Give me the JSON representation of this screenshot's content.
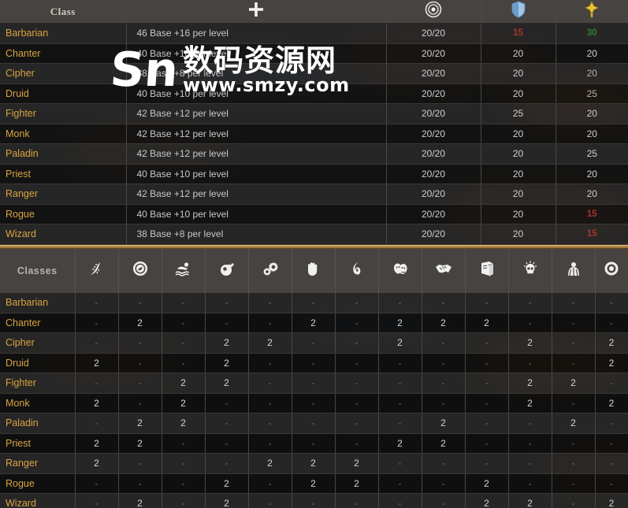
{
  "top_table": {
    "headers": [
      {
        "label": "Class",
        "icon": null,
        "name": "class"
      },
      {
        "label": "",
        "icon": "health-plus-icon",
        "name": "health"
      },
      {
        "label": "",
        "icon": "accuracy-target-icon",
        "name": "accuracy"
      },
      {
        "label": "",
        "icon": "deflection-shield-icon",
        "name": "deflection"
      },
      {
        "label": "",
        "icon": "defense-cross-icon",
        "name": "defense"
      }
    ],
    "rows": [
      {
        "cls": "Barbarian",
        "health": "46 Base +16 per level",
        "accuracy": "20/20",
        "deflection": "15",
        "deflection_style": "red",
        "defense": "30",
        "defense_style": "green"
      },
      {
        "cls": "Chanter",
        "health": "40 Base +10 per level",
        "accuracy": "20/20",
        "deflection": "20",
        "deflection_style": "",
        "defense": "20",
        "defense_style": ""
      },
      {
        "cls": "Cipher",
        "health": "38 Base +8 per level",
        "accuracy": "20/20",
        "deflection": "20",
        "deflection_style": "",
        "defense": "20",
        "defense_style": "dim"
      },
      {
        "cls": "Druid",
        "health": "40 Base +10 per level",
        "accuracy": "20/20",
        "deflection": "20",
        "deflection_style": "",
        "defense": "25",
        "defense_style": "dim"
      },
      {
        "cls": "Fighter",
        "health": "42 Base +12 per level",
        "accuracy": "20/20",
        "deflection": "25",
        "deflection_style": "",
        "defense": "20",
        "defense_style": ""
      },
      {
        "cls": "Monk",
        "health": "42 Base +12 per level",
        "accuracy": "20/20",
        "deflection": "20",
        "deflection_style": "",
        "defense": "20",
        "defense_style": ""
      },
      {
        "cls": "Paladin",
        "health": "42 Base +12 per level",
        "accuracy": "20/20",
        "deflection": "20",
        "deflection_style": "",
        "defense": "25",
        "defense_style": ""
      },
      {
        "cls": "Priest",
        "health": "40 Base +10 per level",
        "accuracy": "20/20",
        "deflection": "20",
        "deflection_style": "",
        "defense": "20",
        "defense_style": ""
      },
      {
        "cls": "Ranger",
        "health": "42 Base +12 per level",
        "accuracy": "20/20",
        "deflection": "20",
        "deflection_style": "",
        "defense": "20",
        "defense_style": ""
      },
      {
        "cls": "Rogue",
        "health": "40 Base +10 per level",
        "accuracy": "20/20",
        "deflection": "20",
        "deflection_style": "",
        "defense": "15",
        "defense_style": "red"
      },
      {
        "cls": "Wizard",
        "health": "38 Base +8 per level",
        "accuracy": "20/20",
        "deflection": "20",
        "deflection_style": "",
        "defense": "15",
        "defense_style": "red"
      }
    ]
  },
  "bottom_table": {
    "corner_label": "Classes",
    "skill_icons": [
      "survival-fern-icon",
      "lore-seal-icon",
      "athletics-swimmer-icon",
      "alchemy-flask-icon",
      "mechanics-gears-icon",
      "stealth-hand-icon",
      "explosives-fuse-icon",
      "theatrics-masks-icon",
      "diplomacy-handshake-icon",
      "history-book-icon",
      "arcana-skull-icon",
      "crafting-figure-icon",
      "metaphysics-orb-icon"
    ],
    "rows": [
      {
        "cls": "Barbarian",
        "vals": [
          "-",
          "-",
          "-",
          "-",
          "-",
          "-",
          "-",
          "-",
          "-",
          "-",
          "-",
          "-",
          "-"
        ]
      },
      {
        "cls": "Chanter",
        "vals": [
          "-",
          "2",
          "-",
          "-",
          "-",
          "2",
          "-",
          "2",
          "2",
          "2",
          "-",
          "-",
          "-"
        ]
      },
      {
        "cls": "Cipher",
        "vals": [
          "-",
          "-",
          "-",
          "2",
          "2",
          "-",
          "-",
          "2",
          "-",
          "-",
          "2",
          "-",
          "2"
        ]
      },
      {
        "cls": "Druid",
        "vals": [
          "2",
          "-",
          "-",
          "2",
          "-",
          "-",
          "-",
          "-",
          "-",
          "-",
          "-",
          "-",
          "2"
        ]
      },
      {
        "cls": "Fighter",
        "vals": [
          "-",
          "-",
          "2",
          "2",
          "-",
          "-",
          "-",
          "-",
          "-",
          "-",
          "2",
          "2",
          "-"
        ]
      },
      {
        "cls": "Monk",
        "vals": [
          "2",
          "-",
          "2",
          "-",
          "-",
          "-",
          "-",
          "-",
          "-",
          "-",
          "2",
          "-",
          "2"
        ]
      },
      {
        "cls": "Paladin",
        "vals": [
          "-",
          "2",
          "2",
          "-",
          "-",
          "-",
          "-",
          "-",
          "2",
          "-",
          "-",
          "2",
          "-"
        ]
      },
      {
        "cls": "Priest",
        "vals": [
          "2",
          "2",
          "-",
          "-",
          "-",
          "-",
          "-",
          "2",
          "2",
          "-",
          "-",
          "-",
          "-"
        ]
      },
      {
        "cls": "Ranger",
        "vals": [
          "2",
          "-",
          "-",
          "-",
          "2",
          "2",
          "2",
          "-",
          "-",
          "-",
          "-",
          "-",
          "-"
        ]
      },
      {
        "cls": "Rogue",
        "vals": [
          "-",
          "-",
          "-",
          "2",
          "-",
          "2",
          "2",
          "-",
          "-",
          "2",
          "-",
          "-",
          "-"
        ]
      },
      {
        "cls": "Wizard",
        "vals": [
          "-",
          "2",
          "-",
          "2",
          "-",
          "-",
          "-",
          "-",
          "-",
          "2",
          "2",
          "-",
          "2"
        ]
      }
    ]
  },
  "watermark": {
    "logo": "Sn",
    "cn_text": "数码资源网",
    "url": "www.smzy.com"
  },
  "colors": {
    "accent_gold": "#d9a441",
    "divider": "#c79a52",
    "header_bg": "#464340",
    "value_red": "#a8332e",
    "value_green": "#2d7d3f"
  }
}
